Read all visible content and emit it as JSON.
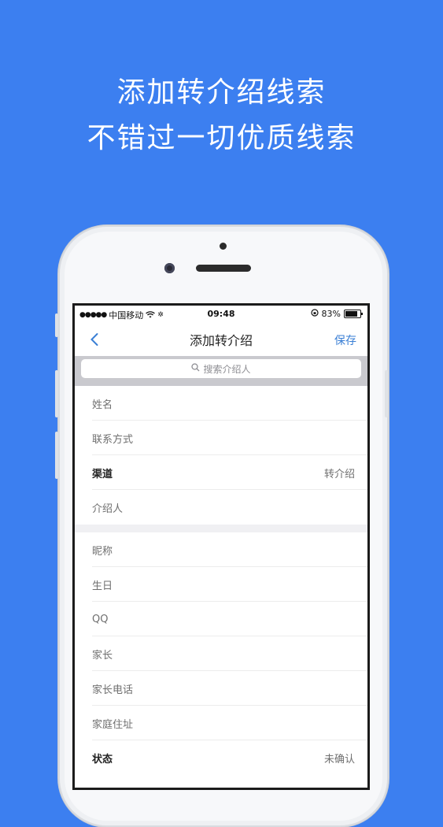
{
  "headline": {
    "line1": "添加转介绍线索",
    "line2": "不错过一切优质线索"
  },
  "status_bar": {
    "carrier": "中国移动",
    "time": "09:48",
    "battery": "83%"
  },
  "nav": {
    "title": "添加转介绍",
    "save_label": "保存"
  },
  "search": {
    "placeholder": "搜索介绍人"
  },
  "group1": [
    {
      "label": "姓名",
      "value": ""
    },
    {
      "label": "联系方式",
      "value": ""
    },
    {
      "label": "渠道",
      "value": "转介绍"
    },
    {
      "label": "介绍人",
      "value": ""
    }
  ],
  "group2": [
    {
      "label": "昵称",
      "value": ""
    },
    {
      "label": "生日",
      "value": ""
    },
    {
      "label": "QQ",
      "value": ""
    },
    {
      "label": "家长",
      "value": ""
    },
    {
      "label": "家长电话",
      "value": ""
    },
    {
      "label": "家庭住址",
      "value": ""
    },
    {
      "label": "状态",
      "value": "未确认"
    }
  ],
  "colors": {
    "background": "#3c7ff0",
    "accent": "#3a7fd5"
  },
  "icons": [
    "back-chevron-icon",
    "search-icon",
    "wifi-icon",
    "signal-icon",
    "battery-icon",
    "lock-rotation-icon"
  ]
}
